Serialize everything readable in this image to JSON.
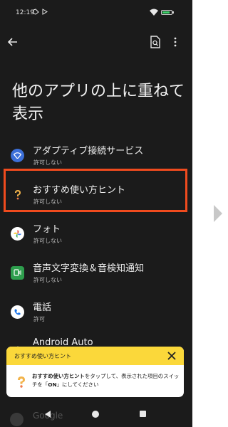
{
  "status_bar": {
    "time": "12:19"
  },
  "title": "他のアプリの上に重ねて表示",
  "apps": [
    {
      "name": "アダプティブ接続サービス",
      "status": "許可しない",
      "icon": "adaptive-connectivity-icon"
    },
    {
      "name": "おすすめ使い方ヒント",
      "status": "許可しない",
      "icon": "tips-icon"
    },
    {
      "name": "フォト",
      "status": "許可しない",
      "icon": "photos-icon"
    },
    {
      "name": "音声文字変換＆音検知通知",
      "status": "許可しない",
      "icon": "live-transcribe-icon"
    },
    {
      "name": "電話",
      "status": "許可",
      "icon": "phone-icon"
    },
    {
      "name": "Android Auto",
      "status": "",
      "icon": "android-auto-icon"
    }
  ],
  "tooltip": {
    "title": "おすすめ使い方ヒント",
    "body_bold1": "おすすめ使い方ヒント",
    "body_text1": "をタップして、表示された項目のスイッチを「",
    "body_bold2": "ON",
    "body_text2": "」にしてください"
  },
  "partial_row": "Google",
  "colors": {
    "highlight": "#f04b1e",
    "tooltip_header": "#fbd83a",
    "background": "#1b1b1b"
  }
}
